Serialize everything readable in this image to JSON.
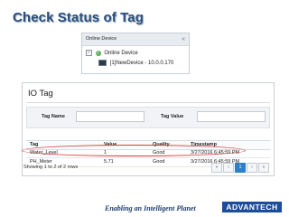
{
  "slide": {
    "title": "Check Status of Tag",
    "tagline": "Enabling an Intelligent Planet",
    "logo_text": "ADVANTECH"
  },
  "device_panel": {
    "header": "Online Device",
    "collapse_icon": "double-chevron-left-icon",
    "root_label": "Online Device",
    "device_label": "[1]NewDevice - 10.0.0.170"
  },
  "io_panel": {
    "title": "IO Tag",
    "filters": {
      "tag_name_label": "Tag Name",
      "tag_value_label": "Tag Value",
      "tag_name_value": "",
      "tag_value_value": ""
    },
    "columns": [
      "Tag",
      "Value",
      "Quality",
      "Timestamp"
    ],
    "rows": [
      {
        "tag": "Water_Level",
        "value": "1",
        "quality": "Good",
        "timestamp": "3/27/2016 6:45:59 PM"
      },
      {
        "tag": "PH_Meter",
        "value": "5.71",
        "quality": "Good",
        "timestamp": "3/27/2016 6:45:59 PM"
      }
    ],
    "footer": "Showing 1 to 2 of 2 rows",
    "pager": [
      "«",
      "‹",
      "1",
      "›",
      "»"
    ],
    "current_page": "1"
  },
  "colors": {
    "title": "#2a4f7a",
    "highlight": "#d63a3a",
    "pager_active": "#2e7fc9",
    "logo_bg": "#1b4d9b"
  }
}
